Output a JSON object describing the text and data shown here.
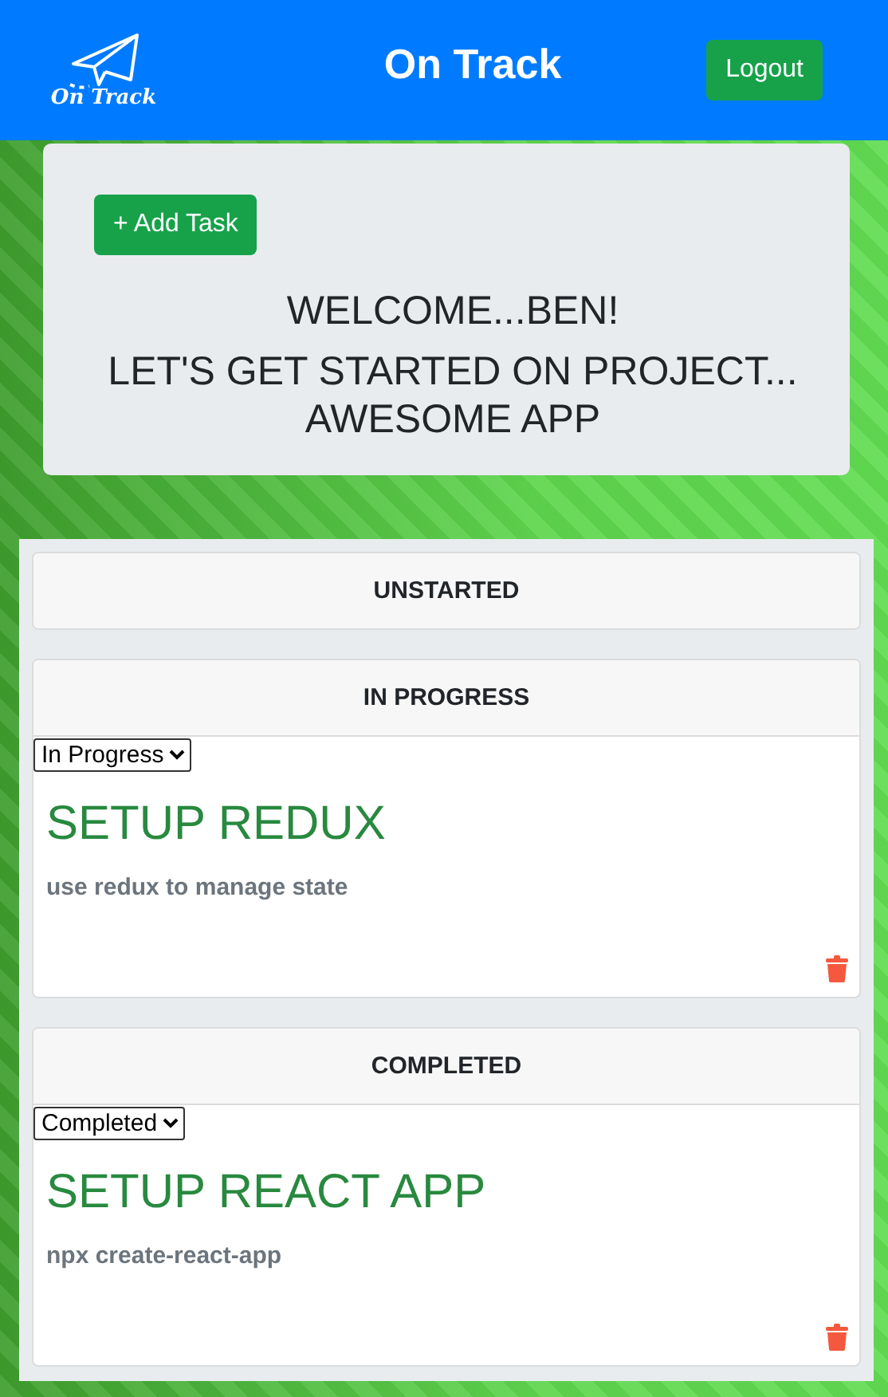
{
  "header": {
    "logo_text": "On Track",
    "title": "On Track",
    "logout_button": "Logout"
  },
  "welcome": {
    "add_button": "+ Add Task",
    "greeting": "WELCOME...BEN!",
    "project_line": "LET'S GET STARTED ON PROJECT... AWESOME APP"
  },
  "columns": [
    {
      "title": "UNSTARTED"
    },
    {
      "title": "IN PROGRESS",
      "tasks": [
        {
          "status": "In Progress",
          "title": "SETUP REDUX",
          "description": "use redux to manage state"
        }
      ]
    },
    {
      "title": "COMPLETED",
      "tasks": [
        {
          "status": "Completed",
          "title": "SETUP REACT APP",
          "description": "npx create-react-app"
        }
      ]
    }
  ]
}
